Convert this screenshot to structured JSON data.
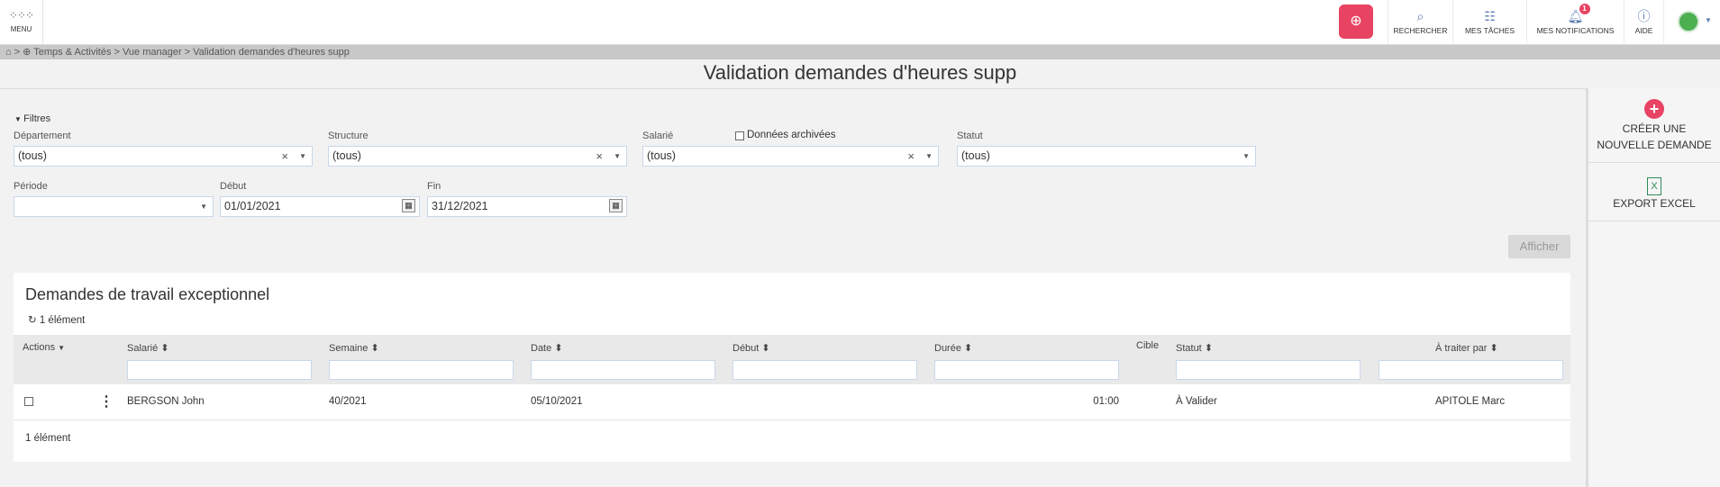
{
  "topbar": {
    "menu_label": "MENU",
    "buttons": [
      {
        "label": "RECHERCHER",
        "icon": "search-icon"
      },
      {
        "label": "MES TÂCHES",
        "icon": "tasks-icon"
      },
      {
        "label": "MES NOTIFICATIONS",
        "icon": "bell-icon",
        "badge": "1"
      },
      {
        "label": "AIDE",
        "icon": "help-icon"
      }
    ],
    "accent": "#e84363"
  },
  "breadcrumb": {
    "text": "⌂ > ⊕ Temps & Activités > Vue manager > Validation demandes d'heures supp"
  },
  "page_title": "Validation demandes d'heures supp",
  "filters": {
    "toggle_label": "Filtres",
    "departement": {
      "label": "Département",
      "value": "(tous)"
    },
    "structure": {
      "label": "Structure",
      "value": "(tous)"
    },
    "salarie": {
      "label": "Salarié",
      "value": "(tous)"
    },
    "archived_label": "Données archivées",
    "statut": {
      "label": "Statut",
      "value": "(tous)"
    },
    "periode": {
      "label": "Période",
      "value": ""
    },
    "debut": {
      "label": "Début",
      "value": "01/01/2021"
    },
    "fin": {
      "label": "Fin",
      "value": "31/12/2021"
    },
    "afficher_label": "Afficher"
  },
  "side_actions": [
    {
      "label": "CRÉER UNE NOUVELLE DEMANDE",
      "icon": "plus-circle-icon"
    },
    {
      "label": "EXPORT EXCEL",
      "icon": "excel-icon"
    }
  ],
  "table": {
    "title": "Demandes de travail exceptionnel",
    "count_top": "1 élément",
    "columns": {
      "actions": "Actions",
      "salarie": "Salarié",
      "semaine": "Semaine",
      "date": "Date",
      "debut": "Début",
      "duree": "Durée",
      "cible": "Cible",
      "statut": "Statut",
      "traiter": "À traiter par"
    },
    "rows": [
      {
        "salarie": "BERGSON John",
        "semaine": "40/2021",
        "date": "05/10/2021",
        "debut": "",
        "duree": "01:00",
        "cible": "",
        "statut": "À Valider",
        "traiter": "APITOLE Marc"
      }
    ],
    "count_bottom": "1 élément"
  }
}
